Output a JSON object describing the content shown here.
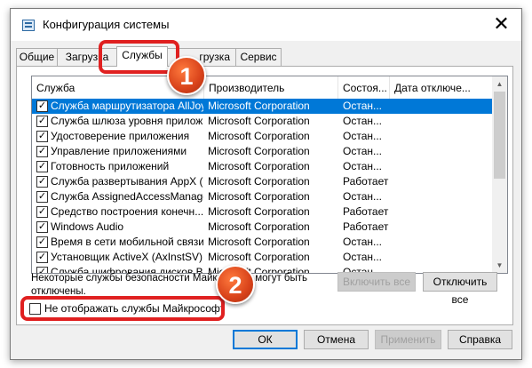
{
  "window": {
    "title": "Конфигурация системы",
    "icon": "msconfig-icon",
    "close_glyph": "✕"
  },
  "tabs": [
    {
      "label": "Общие",
      "active": false
    },
    {
      "label": "Загрузка",
      "active": false
    },
    {
      "label": "Службы",
      "active": true
    },
    {
      "label": "Автозагрузка",
      "active": false
    },
    {
      "label": "Сервис",
      "active": false
    }
  ],
  "tab_visible": {
    "autorun_tail": "грузка"
  },
  "services": {
    "columns": [
      "Служба",
      "Производитель",
      "Состоя...",
      "Дата отключе..."
    ],
    "rows": [
      {
        "checked": true,
        "name": "Служба маршрутизатора AllJoyn",
        "vendor": "Microsoft Corporation",
        "status": "Остан...",
        "date": "",
        "selected": true
      },
      {
        "checked": true,
        "name": "Служба шлюза уровня прилож...",
        "vendor": "Microsoft Corporation",
        "status": "Остан...",
        "date": ""
      },
      {
        "checked": true,
        "name": "Удостоверение приложения",
        "vendor": "Microsoft Corporation",
        "status": "Остан...",
        "date": ""
      },
      {
        "checked": true,
        "name": "Управление приложениями",
        "vendor": "Microsoft Corporation",
        "status": "Остан...",
        "date": ""
      },
      {
        "checked": true,
        "name": "Готовность приложений",
        "vendor": "Microsoft Corporation",
        "status": "Остан...",
        "date": ""
      },
      {
        "checked": true,
        "name": "Служба развертывания AppX (...",
        "vendor": "Microsoft Corporation",
        "status": "Работает",
        "date": ""
      },
      {
        "checked": true,
        "name": "Служба AssignedAccessManager",
        "vendor": "Microsoft Corporation",
        "status": "Остан...",
        "date": ""
      },
      {
        "checked": true,
        "name": "Средство построения конечн...",
        "vendor": "Microsoft Corporation",
        "status": "Работает",
        "date": ""
      },
      {
        "checked": true,
        "name": "Windows Audio",
        "vendor": "Microsoft Corporation",
        "status": "Работает",
        "date": ""
      },
      {
        "checked": true,
        "name": "Время в сети мобильной связи",
        "vendor": "Microsoft Corporation",
        "status": "Остан...",
        "date": ""
      },
      {
        "checked": true,
        "name": "Установщик ActiveX (AxInstSV)",
        "vendor": "Microsoft Corporation",
        "status": "Остан...",
        "date": ""
      },
      {
        "checked": true,
        "name": "Служба шифрования дисков Bit...",
        "vendor": "Microsoft Corporation",
        "status": "Остан...",
        "date": ""
      }
    ]
  },
  "note": "Некоторые службы безопасности Майкрософт могут быть отключены.",
  "buttons": {
    "enable_all": "Включить все",
    "disable_all": "Отключить все",
    "ok": "ОК",
    "cancel": "Отмена",
    "apply": "Применить",
    "help": "Справка"
  },
  "hide_ms_checkbox": {
    "label": "Не отображать службы Майкрософт",
    "checked": false
  },
  "annotations": {
    "step1": "1",
    "step2": "2",
    "color": "#e02020"
  },
  "colors": {
    "selection": "#0078d7",
    "window_bg": "#f0f0f0"
  }
}
